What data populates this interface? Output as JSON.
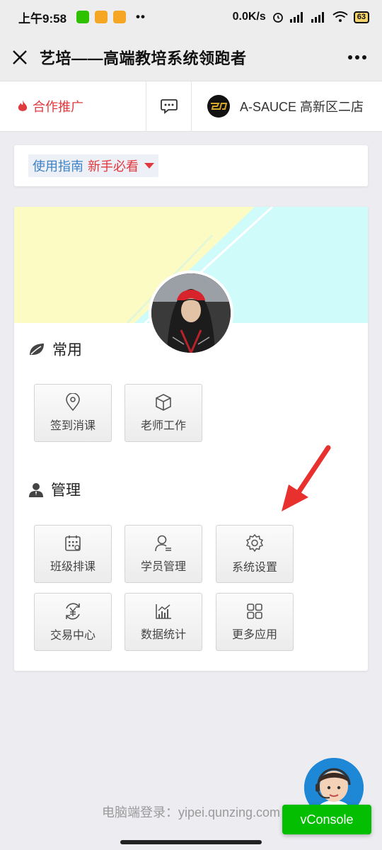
{
  "status_bar": {
    "time": "上午9:58",
    "network_speed": "0.0K/s",
    "battery": "63",
    "more_dots": "••"
  },
  "nav": {
    "title": "艺培——高端教培系统领跑者"
  },
  "top_bar": {
    "promo_label": "合作推广",
    "store_name": "A-SAUCE 高新区二店"
  },
  "guide": {
    "label_a": "使用指南",
    "label_b": "新手必看"
  },
  "sections": {
    "common": {
      "title": "常用",
      "items": [
        {
          "label": "签到消课",
          "icon": "location-pin-icon"
        },
        {
          "label": "老师工作",
          "icon": "cube-icon"
        }
      ]
    },
    "manage": {
      "title": "管理",
      "items": [
        {
          "label": "班级排课",
          "icon": "calendar-icon"
        },
        {
          "label": "学员管理",
          "icon": "student-icon"
        },
        {
          "label": "系统设置",
          "icon": "gear-icon"
        },
        {
          "label": "交易中心",
          "icon": "yuan-exchange-icon"
        },
        {
          "label": "数据统计",
          "icon": "chart-icon"
        },
        {
          "label": "更多应用",
          "icon": "grid-icon"
        }
      ]
    }
  },
  "footer": {
    "login_text": "电脑端登录：yipei.qunzing.com",
    "vconsole_label": "vConsole"
  },
  "colors": {
    "accent_red": "#e0393e",
    "accent_blue": "#3d82c4",
    "vconsole_green": "#04be02",
    "banner_yellow": "#fdfbc4",
    "banner_cyan": "#cffbfb"
  }
}
